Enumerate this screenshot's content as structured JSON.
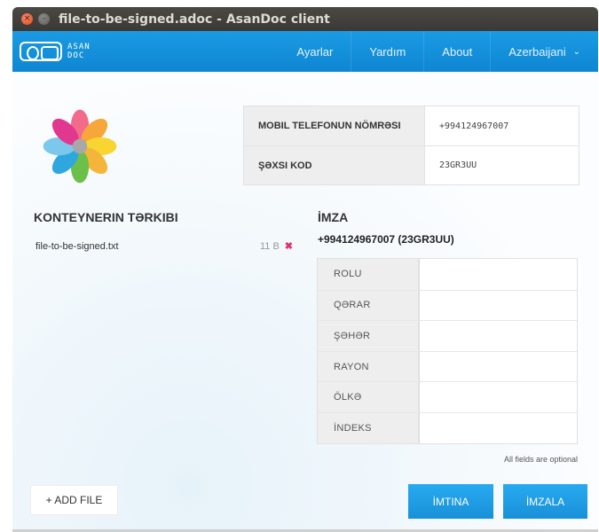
{
  "window": {
    "title": "file-to-be-signed.adoc - AsanDoc client",
    "close_glyph": "×",
    "min_glyph": "–"
  },
  "header": {
    "logo_line1": "ASAN",
    "logo_line2": "DOC",
    "nav": [
      "Ayarlar",
      "Yardım",
      "About"
    ],
    "language": "Azerbaijani",
    "language_chevron": "⌄",
    "accent_color": "#1593dc"
  },
  "identity": {
    "phone_label": "MOBIL TELEFONUN NÖMRƏSI",
    "phone_value": "+994124967007",
    "code_label": "ŞƏXSI KOD",
    "code_value": "23GR3UU"
  },
  "container": {
    "title": "KONTEYNERIN TƏRKIBI",
    "files": [
      {
        "name": "file-to-be-signed.txt",
        "size": "11 B",
        "remove_glyph": "✖"
      }
    ]
  },
  "signature": {
    "title": "İMZA",
    "signer": "+994124967007 (23GR3UU)",
    "fields": [
      "ROLU",
      "QƏRAR",
      "ŞƏHƏR",
      "RAYON",
      "ÖLKƏ",
      "İNDEKS"
    ],
    "note": "All fields are optional"
  },
  "buttons": {
    "add_file": "+ ADD FILE",
    "cancel": "İMTINA",
    "sign": "İMZALA"
  }
}
